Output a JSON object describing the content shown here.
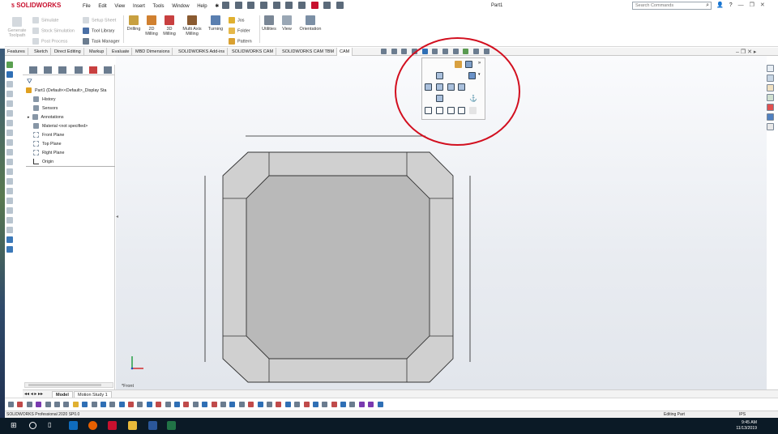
{
  "app": {
    "brand": "SOLIDWORKS",
    "document_title": "Part1",
    "menus": [
      "File",
      "Edit",
      "View",
      "Insert",
      "Tools",
      "Window",
      "Help"
    ],
    "search_placeholder": "Search Commands",
    "help_menu": "?",
    "user_icon": "user-icon"
  },
  "ribbon": {
    "generate_toolpath": "Generate Toolpath",
    "simulate": "Simulate",
    "stock_simulation": "Stock Simulation",
    "post_process": "Post Process",
    "setup_sheet": "Setup Sheet",
    "tool_library": "Tool Library",
    "task_manager": "Task Manager",
    "drilling": "Drilling",
    "milling_2d": "2D Milling",
    "milling_3d": "3D Milling",
    "multi_axis": "Multi Axis Milling",
    "turning": "Turning",
    "jos": "Jos",
    "folder": "Folder",
    "pattern": "Pattern",
    "utilities": "Utilities",
    "view": "View",
    "orientation": "Orientation"
  },
  "tabs": [
    {
      "label": "Features",
      "active": false
    },
    {
      "label": "Sketch",
      "active": false
    },
    {
      "label": "Direct Editing",
      "active": false
    },
    {
      "label": "Markup",
      "active": false
    },
    {
      "label": "Evaluate",
      "active": false
    },
    {
      "label": "MBD Dimensions",
      "active": false
    },
    {
      "label": "SOLIDWORKS Add-ins",
      "active": false
    },
    {
      "label": "SOLIDWORKS CAM",
      "active": false
    },
    {
      "label": "SOLIDWORKS CAM TBM",
      "active": false
    },
    {
      "label": "CAM",
      "active": true
    }
  ],
  "feature_tree": {
    "root": "Part1 (Default<<Default>_Display Sta",
    "items": [
      {
        "label": "History",
        "icon": "history-icon"
      },
      {
        "label": "Sensors",
        "icon": "sensors-icon"
      },
      {
        "label": "Annotations",
        "icon": "annotations-icon"
      },
      {
        "label": "Material <not specified>",
        "icon": "material-icon"
      },
      {
        "label": "Front Plane",
        "icon": "plane-icon"
      },
      {
        "label": "Top Plane",
        "icon": "plane-icon"
      },
      {
        "label": "Right Plane",
        "icon": "plane-icon"
      },
      {
        "label": "Origin",
        "icon": "origin-icon"
      }
    ]
  },
  "viewport": {
    "view_label": "*Front"
  },
  "bottom_tabs": [
    "Model",
    "Motion Study 1"
  ],
  "status": {
    "left": "SOLIDWORKS Professional 2020 SP0.0",
    "middle": "Editing Part",
    "right": "IPS"
  },
  "taskbar": {
    "time": "9:45 AM",
    "date": "11/13/2019"
  },
  "colors": {
    "accent_red": "#d20f1f",
    "part_fill": "#c7c7c7",
    "part_inner": "#b8b8b8",
    "canvas_top": "#fafbfd",
    "canvas_bottom": "#e2e6ec"
  }
}
